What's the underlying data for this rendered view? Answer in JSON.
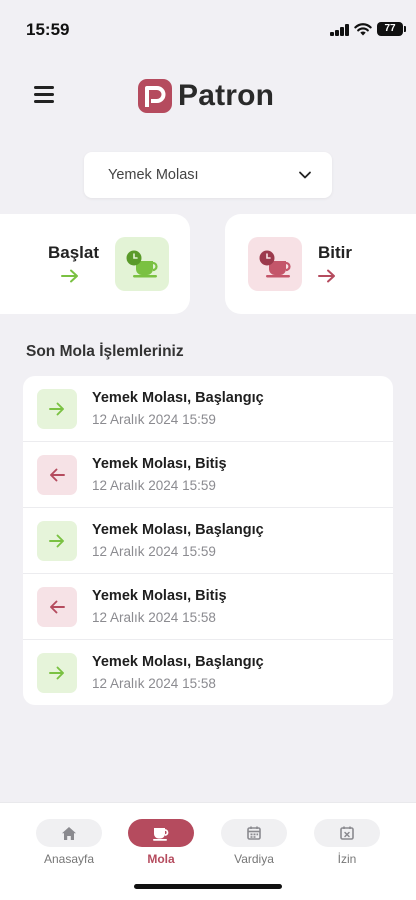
{
  "status_bar": {
    "time": "15:59",
    "battery": "77"
  },
  "header": {
    "app_name": "Patron",
    "menu_icon": "hamburger-menu-icon"
  },
  "break_type_select": {
    "value": "Yemek Molası"
  },
  "actions": {
    "start": {
      "label": "Başlat",
      "icon": "clock-cup-icon",
      "color": "#7ac142"
    },
    "end": {
      "label": "Bitir",
      "icon": "clock-cup-icon",
      "color": "#b54b5e"
    }
  },
  "recent": {
    "title": "Son Mola İşlemleriniz",
    "items": [
      {
        "title": "Yemek Molası, Başlangıç",
        "date": "12 Aralık 2024 15:59",
        "type": "start"
      },
      {
        "title": "Yemek Molası, Bitiş",
        "date": "12 Aralık 2024 15:59",
        "type": "end"
      },
      {
        "title": "Yemek Molası, Başlangıç",
        "date": "12 Aralık 2024 15:59",
        "type": "start"
      },
      {
        "title": "Yemek Molası, Bitiş",
        "date": "12 Aralık 2024 15:58",
        "type": "end"
      },
      {
        "title": "Yemek Molası, Başlangıç",
        "date": "12 Aralık 2024 15:58",
        "type": "start"
      }
    ]
  },
  "bottom_nav": {
    "items": [
      {
        "label": "Anasayfa",
        "icon": "home-icon",
        "active": false
      },
      {
        "label": "Mola",
        "icon": "coffee-cup-icon",
        "active": true
      },
      {
        "label": "Vardiya",
        "icon": "calendar-icon",
        "active": false
      },
      {
        "label": "İzin",
        "icon": "calendar-x-icon",
        "active": false
      }
    ]
  },
  "colors": {
    "accent": "#b54b5e",
    "success": "#7ac142",
    "background": "#f1f0f4"
  }
}
